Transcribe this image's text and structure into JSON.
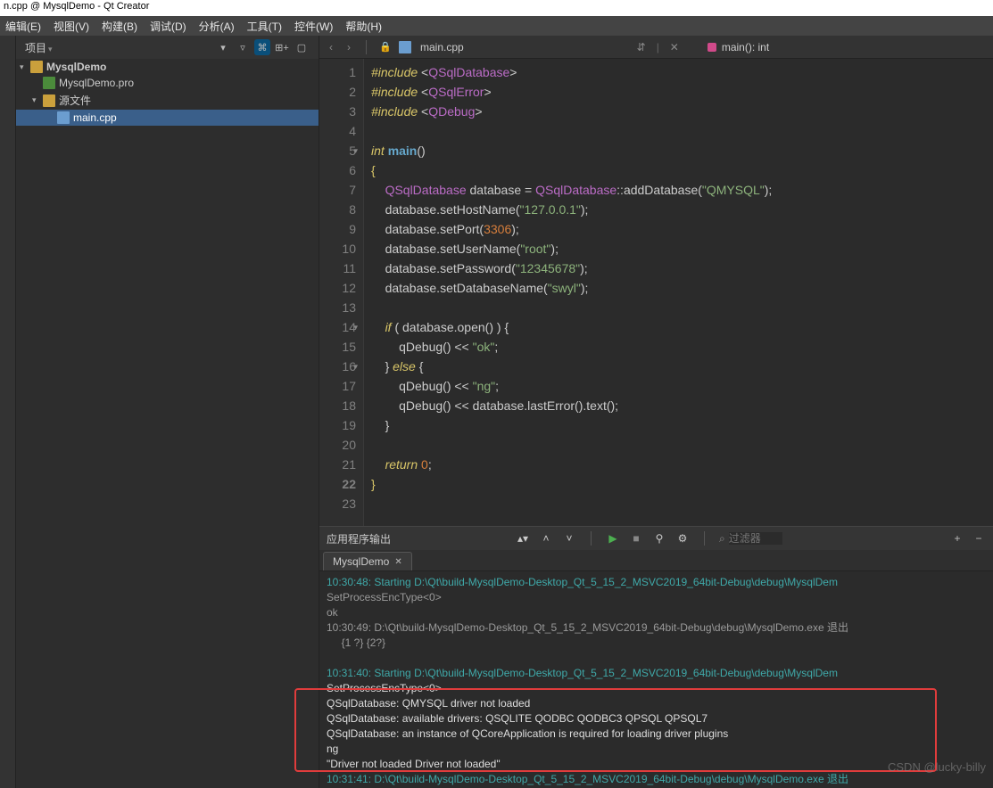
{
  "title": "n.cpp @ MysqlDemo - Qt Creator",
  "menus": [
    "编辑(E)",
    "视图(V)",
    "构建(B)",
    "调试(D)",
    "分析(A)",
    "工具(T)",
    "控件(W)",
    "帮助(H)"
  ],
  "project_panel_title": "项目",
  "tree": {
    "root": "MysqlDemo",
    "pro_file": "MysqlDemo.pro",
    "sources_label": "源文件",
    "main_file": "main.cpp"
  },
  "editor": {
    "tab_file": "main.cpp",
    "symbol": "main(): int",
    "lines": [
      1,
      2,
      3,
      4,
      5,
      6,
      7,
      8,
      9,
      10,
      11,
      12,
      13,
      14,
      15,
      16,
      17,
      18,
      19,
      20,
      21,
      22,
      23
    ],
    "code": {
      "inc": "#include",
      "QSqlDatabase": "QSqlDatabase",
      "QSqlError": "QSqlError",
      "QDebug": "QDebug",
      "int": "int",
      "main": "main",
      "database": "database",
      "addDatabase": "addDatabase",
      "QMYSQL": "\"QMYSQL\"",
      "setHostName": "setHostName",
      "host": "\"127.0.0.1\"",
      "setPort": "setPort",
      "port": "3306",
      "setUserName": "setUserName",
      "user": "\"root\"",
      "setPassword": "setPassword",
      "pass": "\"12345678\"",
      "setDatabaseName": "setDatabaseName",
      "dbname": "\"swyl\"",
      "if": "if",
      "open": "open",
      "qDebug": "qDebug",
      "ok": "\"ok\"",
      "else": "else",
      "ng": "\"ng\"",
      "lastError": "lastError",
      "text": "text",
      "return": "return",
      "zero": "0"
    }
  },
  "output": {
    "panel_title": "应用程序输出",
    "filter_placeholder": "过滤器",
    "tab": "MysqlDemo",
    "lines": {
      "l1": "10:30:48: Starting D:\\Qt\\build-MysqlDemo-Desktop_Qt_5_15_2_MSVC2019_64bit-Debug\\debug\\MysqlDem",
      "l2": "SetProcessEncType<0>",
      "l3": "ok",
      "l4": "10:30:49: D:\\Qt\\build-MysqlDemo-Desktop_Qt_5_15_2_MSVC2019_64bit-Debug\\debug\\MysqlDemo.exe 退出",
      "l5": "     {1 ?} {2?}",
      "l6": "",
      "l7": "10:31:40: Starting D:\\Qt\\build-MysqlDemo-Desktop_Qt_5_15_2_MSVC2019_64bit-Debug\\debug\\MysqlDem",
      "l8": "SetProcessEncType<0>",
      "l9": "QSqlDatabase: QMYSQL driver not loaded",
      "l10": "QSqlDatabase: available drivers: QSQLITE QODBC QODBC3 QPSQL QPSQL7",
      "l11": "QSqlDatabase: an instance of QCoreApplication is required for loading driver plugins",
      "l12": "ng",
      "l13": "\"Driver not loaded Driver not loaded\"",
      "l14": "10:31:41: D:\\Qt\\build-MysqlDemo-Desktop_Qt_5_15_2_MSVC2019_64bit-Debug\\debug\\MysqlDemo.exe 退出"
    }
  },
  "watermark": "CSDN @lucky-billy"
}
